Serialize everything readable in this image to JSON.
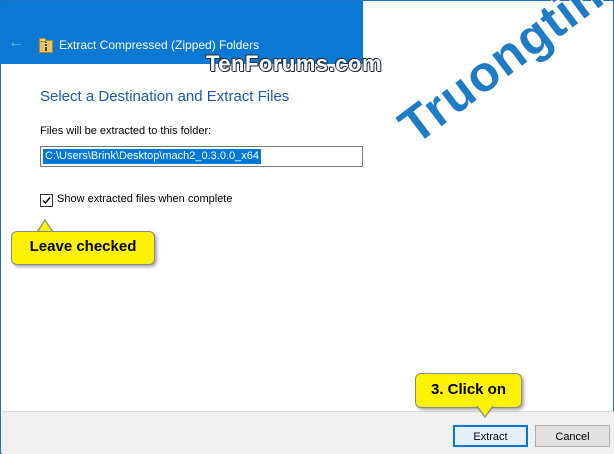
{
  "window": {
    "title": "Extract Compressed (Zipped) Folders"
  },
  "watermarks": {
    "tenforums": "TenForums.com",
    "brand": "Truongtin.top"
  },
  "main": {
    "heading": "Select a Destination and Extract Files",
    "destination_label": "Files will be extracted to this folder:",
    "destination_path": "C:\\Users\\Brink\\Desktop\\mach2_0.3.0.0_x64",
    "show_files_label": "Show extracted files when complete",
    "show_files_checked": true
  },
  "callouts": {
    "checked_note": "Leave checked",
    "extract_note": "3. Click on"
  },
  "footer": {
    "extract_label": "Extract",
    "cancel_label": "Cancel"
  },
  "colors": {
    "titlebar": "#0b78d4",
    "accent": "#0078d7",
    "heading": "#1f5ba8",
    "callout": "#fff200",
    "footer": "#f0f0f0"
  },
  "icons": {
    "back": "back-arrow-icon",
    "folder": "zip-folder-icon",
    "check": "checkmark-icon"
  }
}
